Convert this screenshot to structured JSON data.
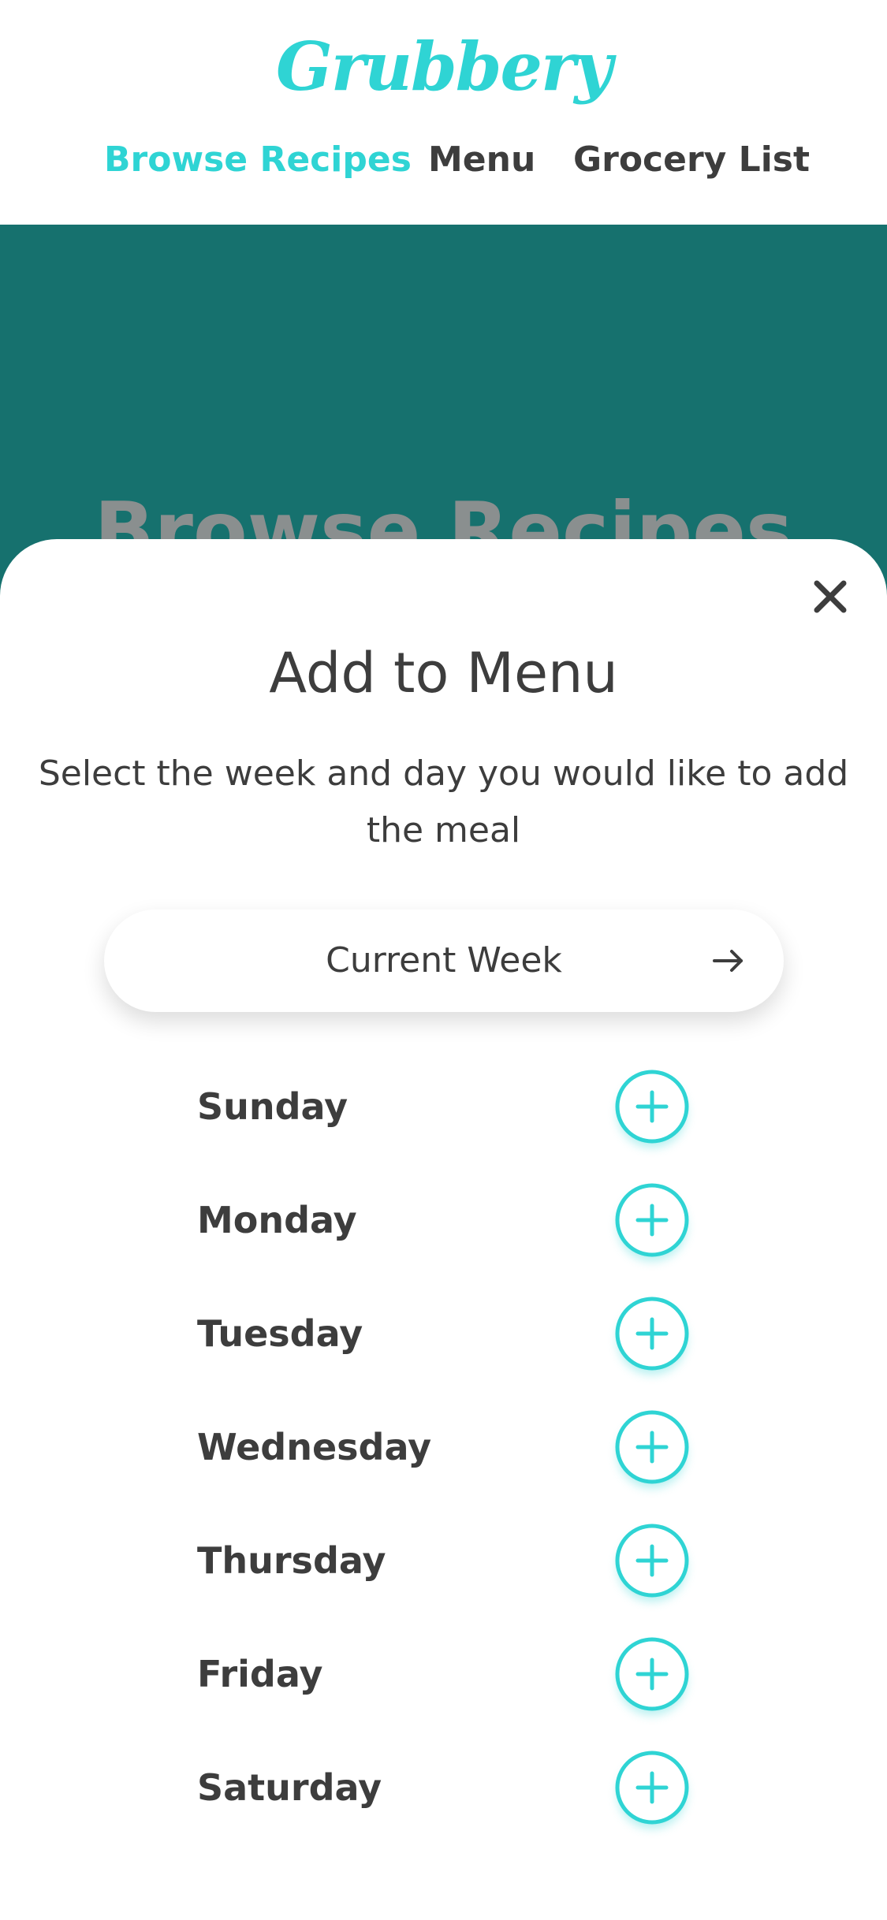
{
  "app": {
    "logo_text": "Grubbery"
  },
  "nav": {
    "items": [
      {
        "label": "Browse Recipes",
        "active": true
      },
      {
        "label": "Menu",
        "active": false
      },
      {
        "label": "Grocery List",
        "active": false
      }
    ]
  },
  "hero": {
    "title": "Browse Recipes"
  },
  "modal": {
    "title": "Add to Menu",
    "description": "Select the week and day you would like to add the meal",
    "week_selector": {
      "label": "Current Week",
      "icon": "arrow-right-icon"
    },
    "close_icon": "close-icon",
    "days": [
      {
        "label": "Sunday",
        "icon": "plus-icon"
      },
      {
        "label": "Monday",
        "icon": "plus-icon"
      },
      {
        "label": "Tuesday",
        "icon": "plus-icon"
      },
      {
        "label": "Wednesday",
        "icon": "plus-icon"
      },
      {
        "label": "Thursday",
        "icon": "plus-icon"
      },
      {
        "label": "Friday",
        "icon": "plus-icon"
      },
      {
        "label": "Saturday",
        "icon": "plus-icon"
      }
    ]
  },
  "colors": {
    "accent": "#2fd4d4",
    "hero_bg": "#16716e",
    "text": "#3d3d3d"
  }
}
